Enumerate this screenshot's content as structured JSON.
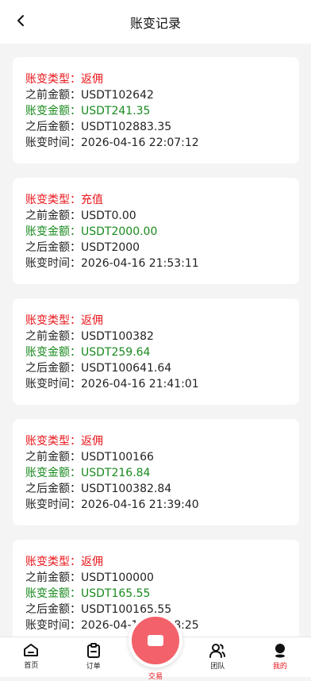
{
  "header": {
    "title": "账变记录"
  },
  "records": [
    {
      "type_label": "账变类型：",
      "type_value": "返佣",
      "before": "之前金额：USDT102642",
      "change_label": "账变金额：",
      "change_value": "USDT241.35",
      "after": "之后金额：USDT102883.35",
      "time": "账变时间：2026-04-16 22:07:12"
    },
    {
      "type_label": "账变类型：",
      "type_value": "充值",
      "before": "之前金额：USDT0.00",
      "change_label": "账变金额：",
      "change_value": "USDT2000.00",
      "after": "之后金额：USDT2000",
      "time": "账变时间：2026-04-16 21:53:11"
    },
    {
      "type_label": "账变类型：",
      "type_value": "返佣",
      "before": "之前金额：USDT100382",
      "change_label": "账变金额：",
      "change_value": "USDT259.64",
      "after": "之后金额：USDT100641.64",
      "time": "账变时间：2026-04-16 21:41:01"
    },
    {
      "type_label": "账变类型：",
      "type_value": "返佣",
      "before": "之前金额：USDT100166",
      "change_label": "账变金额：",
      "change_value": "USDT216.84",
      "after": "之后金额：USDT100382.84",
      "time": "账变时间：2026-04-16 21:39:40"
    },
    {
      "type_label": "账变类型：",
      "type_value": "返佣",
      "before": "之前金额：USDT100000",
      "change_label": "账变金额：",
      "change_value": "USDT165.55",
      "after": "之后金额：USDT100165.55",
      "time": "账变时间：2026-04-16 21:38:25"
    }
  ],
  "tabbar": {
    "home": "首页",
    "orders": "订单",
    "trade": "交易",
    "team": "团队",
    "mine": "我的"
  },
  "colors": {
    "accent": "#e8161b",
    "positive": "#188a1d",
    "fab": "#f3616a"
  }
}
